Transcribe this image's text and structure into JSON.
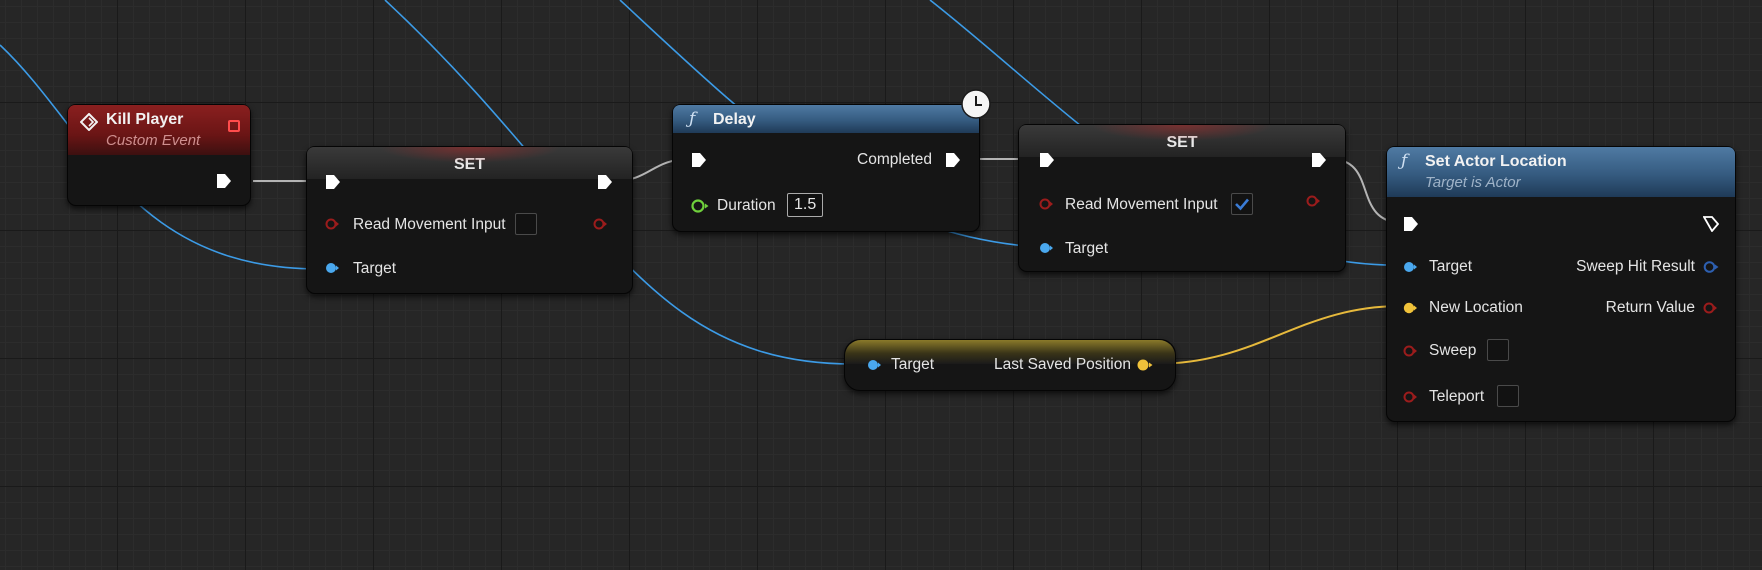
{
  "colors": {
    "exec_wire": "#b4b4b4",
    "object_wire": "#3c9be6",
    "vector_wire": "#e6b93c",
    "bool_pin": "#9b1c1c",
    "object_pin": "#4aa8ee",
    "vector_pin": "#f0c23a",
    "float_pin": "#6fd03c",
    "hitresult_pin": "#2d5fb0",
    "event_header": "#7a1c1c",
    "function_header": "#3d6690"
  },
  "nodes": {
    "kill_player": {
      "title": "Kill Player",
      "subtitle": "Custom Event",
      "icon": "event-diamond-icon"
    },
    "set1": {
      "title": "SET",
      "pins": {
        "read_movement": "Read Movement Input",
        "target": "Target"
      },
      "read_movement_checked": false
    },
    "delay": {
      "title": "Delay",
      "icon": "function-icon",
      "pins": {
        "completed": "Completed",
        "duration": "Duration"
      },
      "duration_value": "1.5",
      "latent_icon": "clock-icon"
    },
    "set2": {
      "title": "SET",
      "pins": {
        "read_movement": "Read Movement Input",
        "target": "Target"
      },
      "read_movement_checked": true
    },
    "last_saved": {
      "pins": {
        "target": "Target",
        "output": "Last Saved Position"
      }
    },
    "set_actor_location": {
      "title": "Set Actor Location",
      "subtitle": "Target is Actor",
      "icon": "function-icon",
      "pins": {
        "target": "Target",
        "new_location": "New Location",
        "sweep": "Sweep",
        "teleport": "Teleport",
        "sweep_hit_result": "Sweep Hit Result",
        "return_value": "Return Value"
      },
      "sweep_checked": false,
      "teleport_checked": false
    }
  }
}
